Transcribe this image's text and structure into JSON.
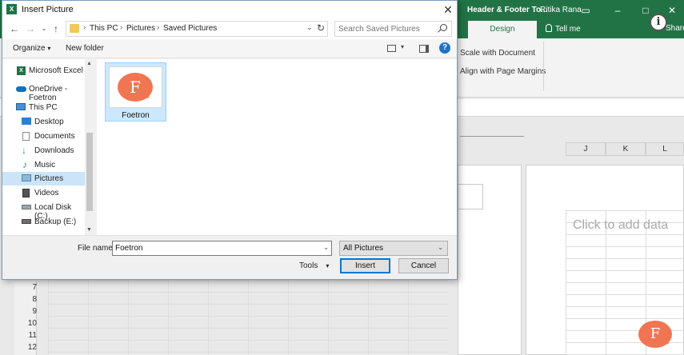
{
  "dialog": {
    "title": "Insert Picture",
    "breadcrumb": [
      "This PC",
      "Pictures",
      "Saved Pictures"
    ],
    "search_placeholder": "Search Saved Pictures",
    "toolbar": {
      "organize": "Organize",
      "new_folder": "New folder",
      "help": "?"
    },
    "nav_items": [
      {
        "label": "Microsoft Excel",
        "icon": "excel-icon",
        "selected": false
      },
      {
        "label": "OneDrive - Foetron",
        "icon": "onedrive-icon",
        "selected": false
      },
      {
        "label": "This PC",
        "icon": "computer-icon",
        "selected": false
      },
      {
        "label": "Desktop",
        "icon": "desktop-icon",
        "selected": false
      },
      {
        "label": "Documents",
        "icon": "documents-icon",
        "selected": false
      },
      {
        "label": "Downloads",
        "icon": "download-icon",
        "selected": false
      },
      {
        "label": "Music",
        "icon": "music-icon",
        "selected": false
      },
      {
        "label": "Pictures",
        "icon": "pictures-icon",
        "selected": true
      },
      {
        "label": "Videos",
        "icon": "videos-icon",
        "selected": false
      },
      {
        "label": "Local Disk (C:)",
        "icon": "disk-icon",
        "selected": false
      },
      {
        "label": "Backup (E:)",
        "icon": "drive-icon",
        "selected": false
      }
    ],
    "files": [
      {
        "name": "Foetron",
        "thumb_letter": "F"
      }
    ],
    "file_name_label": "File name:",
    "file_name_value": "Foetron",
    "file_type": "All Pictures",
    "tools_label": "Tools",
    "insert_label": "Insert",
    "cancel_label": "Cancel"
  },
  "excel": {
    "title": "Header & Footer To...",
    "user": "Ritika Rana",
    "tabs": {
      "design": "Design",
      "tell_me": "Tell me",
      "share": "Share"
    },
    "ribbon_options": [
      "Scale with Document",
      "Align with Page Margins"
    ],
    "columns": [
      "J",
      "K",
      "L"
    ],
    "placeholder": "Click to add data",
    "rows": [
      "7",
      "8",
      "9",
      "10",
      "11",
      "12"
    ]
  },
  "brand": {
    "letter": "F",
    "color": "#f07552"
  },
  "colors": {
    "excel_green": "#217346",
    "selection": "#cce4f7",
    "accent": "#0078d7"
  }
}
